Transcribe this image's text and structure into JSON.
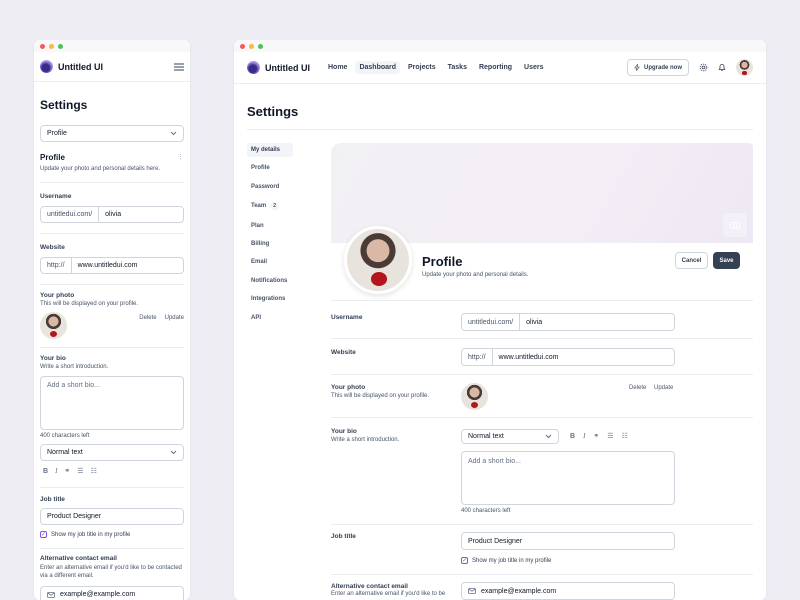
{
  "brand": {
    "name": "Untitled UI"
  },
  "nav": {
    "items": [
      {
        "label": "Home"
      },
      {
        "label": "Dashboard"
      },
      {
        "label": "Projects"
      },
      {
        "label": "Tasks"
      },
      {
        "label": "Reporting"
      },
      {
        "label": "Users"
      }
    ],
    "upgrade_label": "Upgrade now"
  },
  "page": {
    "title": "Settings"
  },
  "settings_nav": {
    "items": [
      {
        "label": "My details"
      },
      {
        "label": "Profile"
      },
      {
        "label": "Password"
      },
      {
        "label": "Team",
        "badge": "2"
      },
      {
        "label": "Plan"
      },
      {
        "label": "Billing"
      },
      {
        "label": "Email"
      },
      {
        "label": "Notifications"
      },
      {
        "label": "Integrations"
      },
      {
        "label": "API"
      }
    ]
  },
  "profile": {
    "title": "Profile",
    "subtitle": "Update your photo and personal details.",
    "subtitle_mobile": "Update your photo and personal details here.",
    "cancel_label": "Cancel",
    "save_label": "Save"
  },
  "form": {
    "username": {
      "label": "Username",
      "prefix": "untitledui.com/",
      "value": "olivia"
    },
    "website": {
      "label": "Website",
      "prefix": "http://",
      "value": "www.untitledui.com"
    },
    "photo": {
      "label": "Your photo",
      "hint": "This will be displayed on your profile.",
      "delete_label": "Delete",
      "update_label": "Update"
    },
    "bio": {
      "label": "Your bio",
      "hint": "Write a short introduction.",
      "placeholder": "Add a short bio...",
      "chars_left": "400 characters left",
      "text_style": "Normal text"
    },
    "job": {
      "label": "Job title",
      "value": "Product Designer",
      "checkbox_label": "Show my job title in my profile"
    },
    "alt_email": {
      "label": "Alternative contact email",
      "hint": "Enter an alternative email if you'd like to be contacted via a different email.",
      "hint_desktop": "Enter an alternative email if you'd like to be",
      "value": "example@example.com"
    }
  },
  "mobile": {
    "select_value": "Profile"
  },
  "colors": {
    "primary": "#344054",
    "accent": "#7f56d9",
    "border": "#d0d5dd"
  }
}
